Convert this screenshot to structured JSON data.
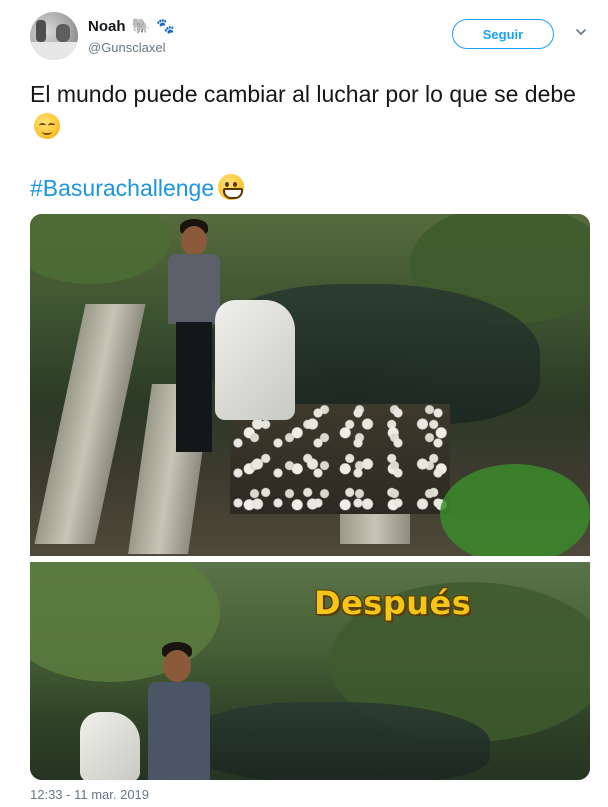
{
  "user": {
    "display_name": "Noah",
    "name_emojis": [
      "🐘",
      "🐾"
    ],
    "handle": "@Gunsclaxel"
  },
  "follow_button": {
    "label": "Seguir"
  },
  "menu": {
    "icon": "chevron-down-icon"
  },
  "tweet": {
    "text": "El mundo puede cambiar al luchar por lo que se debe",
    "hashtag": "#Basurachallenge",
    "timestamp": "12:33 - 11 mar. 2019"
  },
  "media": {
    "caption": "Después"
  },
  "colors": {
    "accent": "#1da1f2",
    "hashtag": "#1b95e0",
    "secondary_text": "#657786",
    "caption": "#f5c518"
  }
}
